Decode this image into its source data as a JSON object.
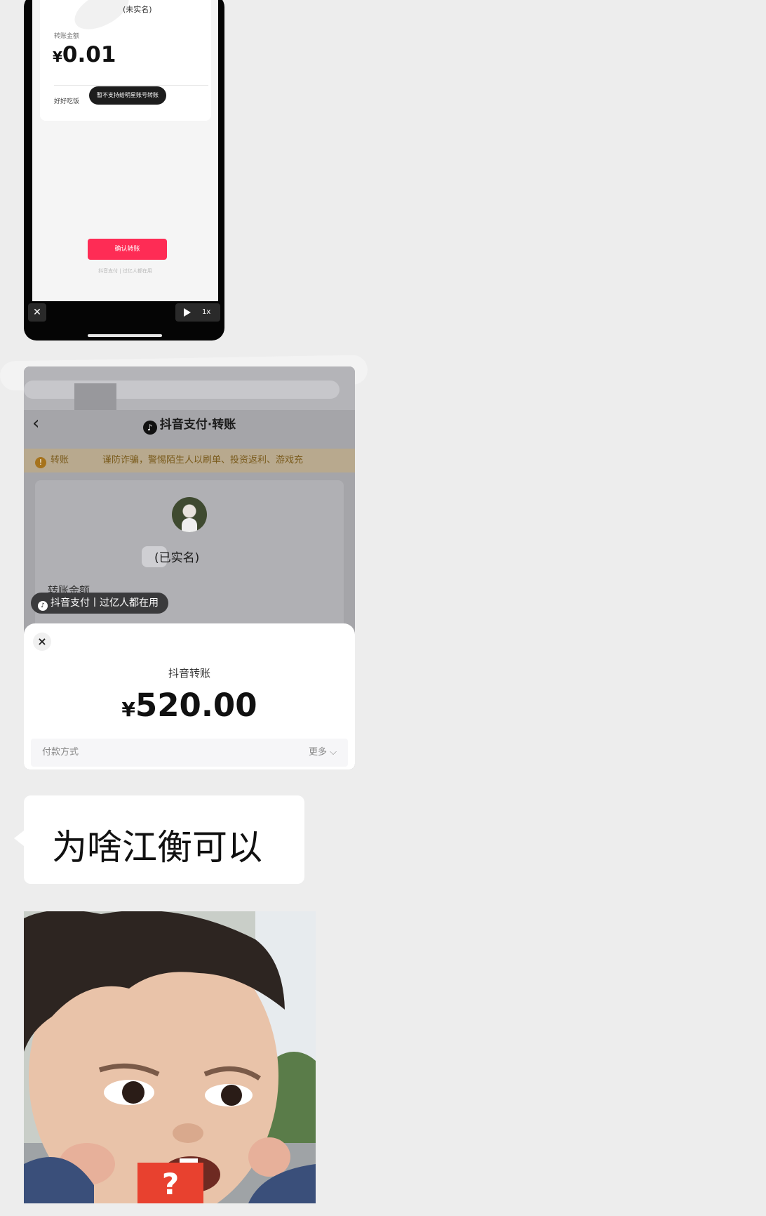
{
  "message1": {
    "unverified_label": "(未实名)",
    "amount_label": "转账金额",
    "amount_symbol": "¥",
    "amount_value": "0.01",
    "note_text": "好好吃饭",
    "toast_text": "暂不支持给明星账号转账",
    "confirm_button": "确认转账",
    "footer_text": "抖音支付 | 过亿人都在用",
    "close_icon": "close-icon",
    "play_icon": "play-icon",
    "speed_label": "1x"
  },
  "message2": {
    "back_icon": "chevron-left-icon",
    "title": "抖音支付·转账",
    "warning_left": "转账",
    "warning_text": "谨防诈骗，警惕陌生人以刷单、投资返利、游戏充",
    "verified_label": "(已实名)",
    "amount_label_partial": "转账金额",
    "pay_badge": "抖音支付丨过亿人都在用",
    "sheet_close": "×",
    "sheet_title": "抖音转账",
    "sheet_amount_symbol": "¥",
    "sheet_amount_value": "520.00",
    "payment_method_label": "付款方式",
    "more_label": "更多 ⌵"
  },
  "message3": {
    "text": "为啥江衡可以"
  },
  "message4": {
    "sticker_badge": "?"
  }
}
